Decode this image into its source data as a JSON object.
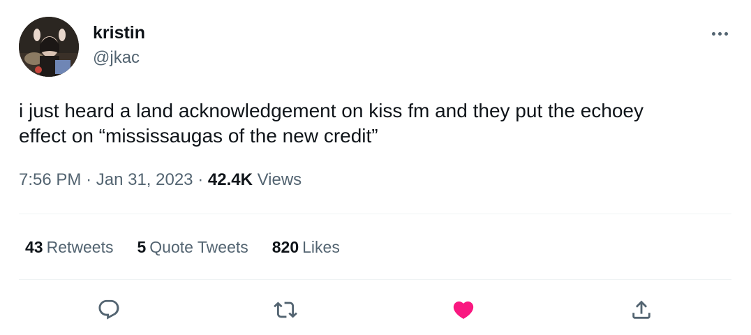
{
  "author": {
    "name": "kristin",
    "handle": "@jkac"
  },
  "tweet": {
    "text": "i just heard a land acknowledgement on kiss fm and they put the echoey\neffect on “mississaugas of the new credit”",
    "time": "7:56 PM",
    "date": "Jan 31, 2023",
    "separator": "·",
    "views_count": "42.4K",
    "views_label": "Views"
  },
  "stats": {
    "retweets_count": "43",
    "retweets_label": "Retweets",
    "quotes_count": "5",
    "quotes_label": "Quote Tweets",
    "likes_count": "820",
    "likes_label": "Likes"
  },
  "actions": {
    "reply_icon": "reply-icon",
    "retweet_icon": "retweet-icon",
    "like_icon": "heart-icon",
    "share_icon": "share-icon",
    "like_color": "#f91880",
    "icon_color": "#536471"
  }
}
